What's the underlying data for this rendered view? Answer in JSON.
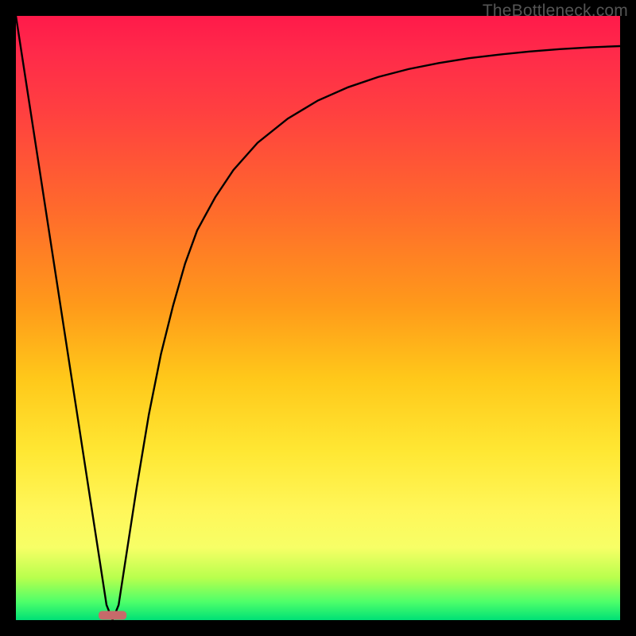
{
  "watermark": "TheBottleneck.com",
  "chart_data": {
    "type": "line",
    "title": "",
    "xlabel": "",
    "ylabel": "",
    "xlim": [
      0,
      100
    ],
    "ylim": [
      0,
      100
    ],
    "grid": false,
    "x": [
      0,
      2,
      4,
      6,
      8,
      10,
      12,
      14,
      15,
      16,
      17,
      18,
      20,
      22,
      24,
      26,
      28,
      30,
      33,
      36,
      40,
      45,
      50,
      55,
      60,
      65,
      70,
      75,
      80,
      85,
      90,
      95,
      100
    ],
    "y": [
      100,
      87,
      74,
      61,
      48,
      35,
      22,
      9,
      2.5,
      0,
      2.5,
      9,
      22,
      34,
      44,
      52,
      59,
      64.5,
      70,
      74.5,
      79,
      83,
      86,
      88.2,
      89.9,
      91.2,
      92.2,
      93,
      93.6,
      94.1,
      94.5,
      94.8,
      95
    ],
    "gradient_stops": [
      {
        "pos": 0.0,
        "color": "#ff1a4a"
      },
      {
        "pos": 0.06,
        "color": "#ff2a4a"
      },
      {
        "pos": 0.16,
        "color": "#ff4040"
      },
      {
        "pos": 0.32,
        "color": "#ff6a2c"
      },
      {
        "pos": 0.48,
        "color": "#ff9a1a"
      },
      {
        "pos": 0.6,
        "color": "#ffc81a"
      },
      {
        "pos": 0.72,
        "color": "#ffe733"
      },
      {
        "pos": 0.82,
        "color": "#fff75a"
      },
      {
        "pos": 0.88,
        "color": "#f7ff66"
      },
      {
        "pos": 0.93,
        "color": "#b8ff4d"
      },
      {
        "pos": 0.97,
        "color": "#4dff6a"
      },
      {
        "pos": 1.0,
        "color": "#00e076"
      }
    ],
    "marker": {
      "x": 16,
      "width": 4.5,
      "color": "#c66a6a"
    }
  }
}
